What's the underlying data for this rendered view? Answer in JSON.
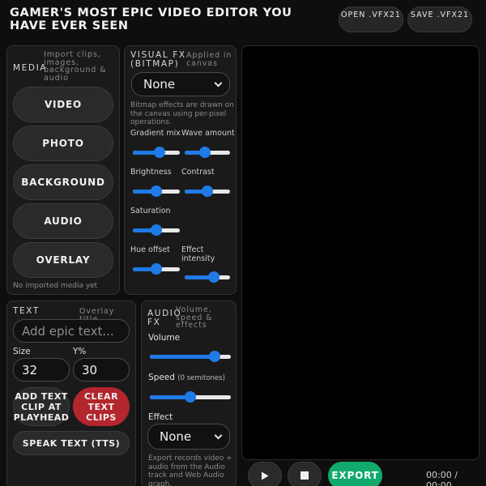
{
  "header": {
    "title": "GAMER'S MOST EPIC VIDEO EDITOR YOU HAVE EVER SEEN",
    "open_label": "OPEN .VFX21",
    "save_label": "SAVE .VFX21"
  },
  "media": {
    "title": "MEDIA",
    "subtitle": "Import clips, images, background & audio",
    "buttons": [
      "VIDEO",
      "PHOTO",
      "BACKGROUND",
      "AUDIO",
      "OVERLAY"
    ],
    "empty_text": "No imported media yet"
  },
  "visual_fx": {
    "title": "VISUAL FX (BITMAP)",
    "subtitle": "Applied in canvas",
    "select_value": "None",
    "description": "Bitmap effects are drawn on the canvas using per-pixel operations.",
    "sliders": [
      {
        "label": "Gradient mix",
        "value": 0.58
      },
      {
        "label": "Wave amount",
        "value": 0.42
      },
      {
        "label": "Brightness",
        "value": 0.5
      },
      {
        "label": "Contrast",
        "value": 0.5
      },
      {
        "label": "Saturation",
        "value": 0.5
      },
      {
        "label": "Hue offset",
        "value": 0.5
      },
      {
        "label": "Effect intensity",
        "value": 0.7
      }
    ]
  },
  "text_panel": {
    "title": "TEXT",
    "subtitle": "Overlay title",
    "text_placeholder": "Add epic text...",
    "size_label": "Size",
    "size_value": "32",
    "y_label": "Y%",
    "y_value": "30",
    "add_button": "ADD TEXT CLIP AT PLAYHEAD",
    "clear_button": "CLEAR TEXT CLIPS",
    "speak_button": "SPEAK TEXT (TTS)"
  },
  "audio_fx": {
    "title": "AUDIO FX",
    "subtitle": "Volume, speed & effects",
    "volume_label": "Volume",
    "volume_value": 0.85,
    "speed_label": "Speed",
    "speed_unit": "(0 semitones)",
    "speed_value": 0.5,
    "effect_label": "Effect",
    "effect_value": "None",
    "note": "Export records video + audio from the Audio track and Web Audio graph."
  },
  "transport": {
    "export_label": "EXPORT",
    "timecode": "00:00 / 00:00"
  },
  "colors": {
    "accent": "#1f7ae6",
    "danger": "#b3262d",
    "export": "#11a96c"
  }
}
